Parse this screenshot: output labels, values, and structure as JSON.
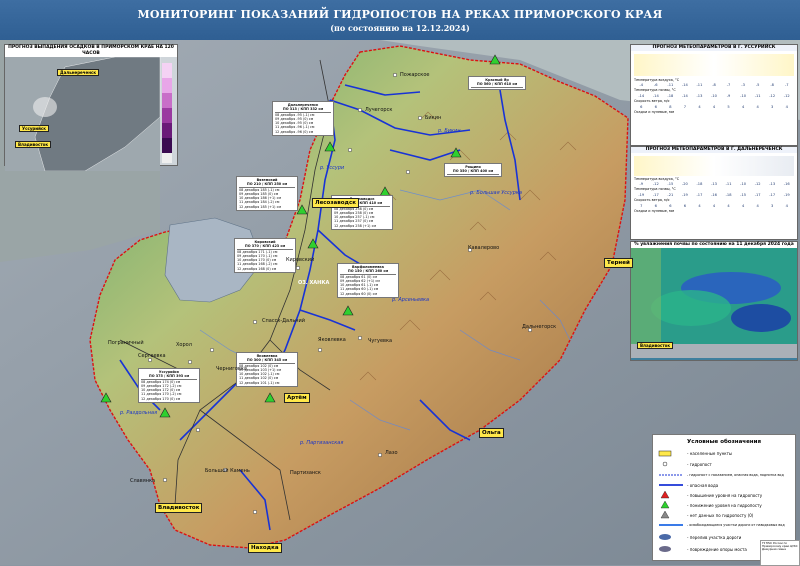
{
  "header": {
    "title": "МОНИТОРИНГ ПОКАЗАНИЙ ГИДРОПОСТОВ НА РЕКАХ ПРИМОРСКОГО КРАЯ",
    "subtitle": "(по состоянию на 12.12.2024)"
  },
  "precip_map": {
    "title": "ПРОГНОЗ ВЫПАДЕНИЯ ОСАДКОВ В ПРИМОРСКОМ КРАЕ НА 120 ЧАСОВ",
    "labels": [
      "Дальнереченск",
      "Уссурийск",
      "Владивосток"
    ]
  },
  "meteogram_ussuriysk": {
    "title": "ПРОГНОЗ МЕТЕОПАРАМЕТРОВ В Г. УССУРИЙСК",
    "rows": [
      [
        "-4",
        "-6",
        "-11",
        "-14",
        "-11",
        "-8",
        "-7",
        "-3",
        "-5",
        "-8",
        "-7",
        "-7"
      ],
      [
        "-14",
        "-14",
        "-18",
        "-14",
        "-13",
        "-10",
        "-9",
        "-10",
        "-11",
        "-12",
        "-12",
        "-17"
      ],
      [
        "6",
        "6",
        "8",
        "7",
        "4",
        "4",
        "5",
        "4",
        "4",
        "3",
        "4",
        "7"
      ]
    ],
    "labels": [
      "Температура воздуха, °С",
      "Температура почвы, °С",
      "Скорость ветра, м/с",
      "Осадки и нулевые, мм"
    ]
  },
  "meteogram_dalnerechensk": {
    "title": "ПРОГНОЗ МЕТЕОПАРАМЕТРОВ В Г. ДАЛЬНЕРЕЧЕНСК",
    "rows": [
      [
        "-9",
        "-12",
        "-15",
        "-20",
        "-18",
        "-13",
        "-11",
        "-10",
        "-12",
        "-13",
        "-16",
        "-14"
      ],
      [
        "-19",
        "-17",
        "-21",
        "-19",
        "-17",
        "-16",
        "-18",
        "-15",
        "-17",
        "-17",
        "-19",
        "-20"
      ],
      [
        "7",
        "6",
        "6",
        "6",
        "4",
        "4",
        "4",
        "4",
        "4",
        "3",
        "4",
        "4"
      ]
    ],
    "labels": [
      "Температура воздуха, °С",
      "Температура почвы, °С",
      "Скорость ветра, м/с",
      "Осадки и нулевые, мм"
    ]
  },
  "soil_map": {
    "title": "% увлажнения почвы по состоянию на 11 декабря 2024 года",
    "label": "Владивосток"
  },
  "cities": [
    "Дальнереченск",
    "Лесозаводск",
    "Артём",
    "Владивосток",
    "Находка",
    "Ольга",
    "Терней",
    "Уссурийск",
    "Арсеньев"
  ],
  "gauges": [
    {
      "name": "Дальнереченск",
      "sub": "ПО 313 / КПП 332 см",
      "rows": [
        "08 декабря -95 (-1) см",
        "09 декабря -95 (0) см",
        "10 декабря -95 (0) см",
        "11 декабря -96 (-1) см",
        "12 декабря -96 (0) см"
      ]
    },
    {
      "name": "Вяземский",
      "sub": "ПО 210 / КПП 250 см",
      "rows": [
        "08 декабря 185 (-1) см",
        "09 декабря 185 (0) см",
        "10 декабря 186 (+1) см",
        "11 декабря 184 (-2) см",
        "12 декабря 185 (+1) см"
      ]
    },
    {
      "name": "Лесозаводск",
      "sub": "ПО 360 / КПП 410 см",
      "rows": [
        "08 декабря 258 (0) см",
        "09 декабря 258 (0) см",
        "10 декабря 257 (-1) см",
        "11 декабря 257 (0) см",
        "12 декабря 258 (+1) см"
      ]
    },
    {
      "name": "Кировский",
      "sub": "ПО 370 / КПП 423 см",
      "rows": [
        "08 декабря 171 (-1) см",
        "09 декабря 170 (-1) см",
        "10 декабря 170 (0) см",
        "11 декабря 168 (-2) см",
        "12 декабря 168 (0) см"
      ]
    },
    {
      "name": "Варфоломеевка",
      "sub": "ПО 150 / КПП 260 см",
      "rows": [
        "08 декабря 61 (0) см",
        "09 декабря 62 (+1) см",
        "10 декабря 61 (-1) см",
        "11 декабря 60 (-1) см",
        "12 декабря 60 (0) см"
      ]
    },
    {
      "name": "Яковлевка",
      "sub": "ПО 300 / КПП 345 см",
      "rows": [
        "08 декабря 102 (0) см",
        "09 декабря 103 (+1) см",
        "10 декабря 102 (-1) см",
        "11 декабря 102 (0) см",
        "12 декабря 101 (-1) см"
      ]
    },
    {
      "name": "Уссурийск",
      "sub": "ПО 375 / КПП 393 см",
      "rows": [
        "08 декабря 174 (0) см",
        "09 декабря 172 (-2) см",
        "10 декабря 172 (0) см",
        "11 декабря 170 (-2) см",
        "12 декабря 170 (0) см"
      ]
    },
    {
      "name": "Арсеньев",
      "sub": "ПО 450 / КПП 500 см",
      "rows": [
        "08 декабря 118 (-1) см",
        "09 декабря 118 (0) см",
        "10 декабря 117 (-1) см",
        "11 декабря 117 (0) см",
        "12 декабря 116 (-1) см"
      ]
    },
    {
      "name": "Рощино",
      "sub": "ПО 350 / КПП 400 см",
      "rows": [
        "08 декабря 95 (0) см",
        "09 декабря 95 (0) см",
        "10 декабря 94 (-1) см",
        "11 декабря 94 (0) см",
        "12 декабря 93 (-1) см"
      ]
    },
    {
      "name": "Красный Яр",
      "sub": "ПО 560 / КПП 610 см",
      "rows": [
        "08 декабря 170 (0) см",
        "09 декабря 170 (0) см",
        "10 декабря 169 (-1) см",
        "11 декабря 169 (0) см",
        "12 декабря 168 (-1) см"
      ]
    }
  ],
  "places": [
    "Пожарское",
    "Лучегорск",
    "Бикин",
    "Рощино",
    "Кировский",
    "Хорол",
    "Сергеевка",
    "Спасск-Дальний",
    "Черниговка",
    "Ханкайский",
    "Покровка",
    "Яковлевка",
    "Чугуевка",
    "Кавалерово",
    "Дальнегорск",
    "Лазо",
    "Партизанск",
    "Большой Камень",
    "Славянка",
    "Фокино",
    "Пограничный",
    "Камень-Рыболов"
  ],
  "rivers": [
    "р. Бикин",
    "р. Уссури",
    "р. Арсеньевка",
    "р. Илистая",
    "р. Партизанская",
    "р. Раздольная",
    "р. Большая Уссурка",
    "р. Малиновка",
    "р. Журавлёвка",
    "р. Киевка",
    "р. Павловка"
  ],
  "lake": "ОЗ. ХАНКА",
  "legend": {
    "title": "Условные обозначения",
    "items": [
      "- населенные пункты",
      "- гидропост",
      "- гидропост с показанием, опасная вода, подпитка вод",
      "- опасная вода",
      "- повышение уровня на гидропосту",
      "- понижение уровня на гидропосту",
      "- нет данных по гидропосту (0)",
      "- освобождающиеся участки дороги от паводковых вод",
      "- перелив участка дороги",
      "- повреждение опоры моста"
    ]
  },
  "stamp": "ГУ МЧС России по Приморскому краю ЦУКС Дежурная смена"
}
